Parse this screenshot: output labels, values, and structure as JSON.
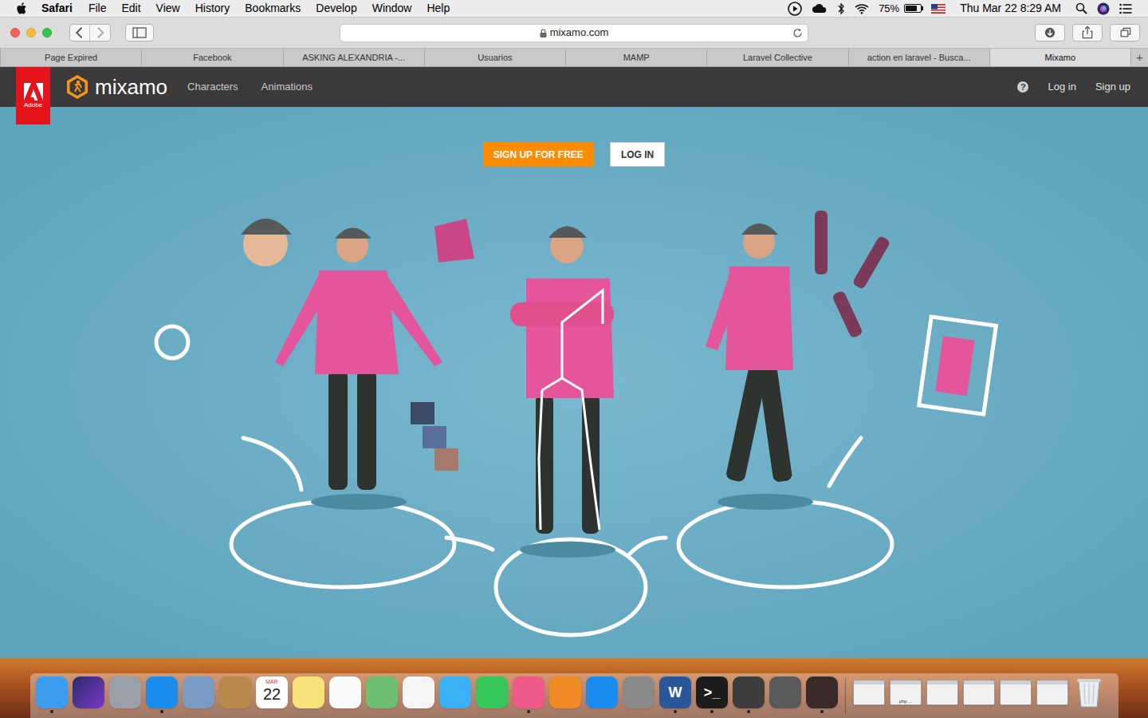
{
  "menubar": {
    "app": "Safari",
    "items": [
      "File",
      "Edit",
      "View",
      "History",
      "Bookmarks",
      "Develop",
      "Window",
      "Help"
    ],
    "battery": {
      "reading": "75%",
      "level": 0.75
    },
    "clock": "Thu Mar 22 8:29 AM"
  },
  "toolbar": {
    "address": "mixamo.com"
  },
  "tabs": [
    {
      "label": "Page Expired",
      "selected": false
    },
    {
      "label": "Facebook",
      "selected": false
    },
    {
      "label": "ASKING ALEXANDRIA -...",
      "selected": false
    },
    {
      "label": "Usuarios",
      "selected": false
    },
    {
      "label": "MAMP",
      "selected": false
    },
    {
      "label": "Laravel Collective",
      "selected": false
    },
    {
      "label": "action en laravel - Busca...",
      "selected": false
    },
    {
      "label": "Mixamo",
      "selected": true
    }
  ],
  "new_tab": "+",
  "site": {
    "adobe": "Adobe",
    "logo": "mixamo",
    "nav": [
      "Characters",
      "Animations"
    ],
    "help": "?",
    "account": [
      "Log in",
      "Sign up"
    ],
    "hero_buttons": [
      "SIGN UP FOR FREE",
      "LOG IN"
    ]
  },
  "dock": {
    "items": [
      {
        "kind": "app",
        "running": true
      },
      {
        "kind": "app",
        "running": false
      },
      {
        "kind": "app",
        "running": false
      },
      {
        "kind": "app",
        "running": true
      },
      {
        "kind": "app",
        "running": false
      },
      {
        "kind": "app",
        "running": false
      },
      {
        "kind": "calendar",
        "running": false,
        "month": "MAR",
        "day": "22"
      },
      {
        "kind": "app",
        "running": false
      },
      {
        "kind": "app",
        "running": false
      },
      {
        "kind": "app",
        "running": false
      },
      {
        "kind": "app",
        "running": false
      },
      {
        "kind": "app",
        "running": false
      },
      {
        "kind": "app",
        "running": false
      },
      {
        "kind": "app",
        "running": true
      },
      {
        "kind": "app",
        "running": false
      },
      {
        "kind": "app",
        "running": false
      },
      {
        "kind": "app",
        "running": false
      },
      {
        "kind": "label",
        "running": true,
        "text": "W"
      },
      {
        "kind": "label",
        "running": true,
        "text": ">_"
      },
      {
        "kind": "app",
        "running": true
      },
      {
        "kind": "app",
        "running": false
      },
      {
        "kind": "app",
        "running": true
      },
      {
        "kind": "window",
        "running": false
      },
      {
        "kind": "window",
        "running": false,
        "caption": "php ..."
      },
      {
        "kind": "window",
        "running": false
      },
      {
        "kind": "window",
        "running": false
      },
      {
        "kind": "window",
        "running": false
      },
      {
        "kind": "window",
        "running": false
      },
      {
        "kind": "trash",
        "running": false
      }
    ]
  }
}
